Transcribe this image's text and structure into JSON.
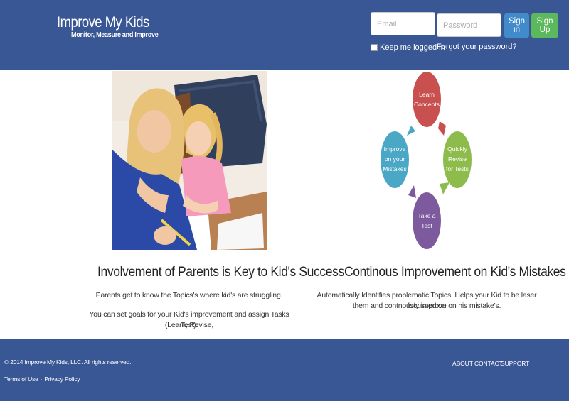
{
  "header": {
    "brand_title": "Improve My Kids",
    "brand_tagline": "Monitor, Measure and Improve",
    "email_placeholder": "Email",
    "password_placeholder": "Password",
    "sign_in_label": "Sign in",
    "sign_up_label": "Sign Up",
    "keep_logged_in_label": "Keep me logged in",
    "forgot_password_label": "Forgot your password?"
  },
  "cycle": {
    "learn": [
      "Learn",
      "Concepts"
    ],
    "revise": [
      "Quickly",
      "Revise",
      "for Tests"
    ],
    "test": [
      "Take a",
      "Test"
    ],
    "improve": [
      "Improve",
      "on your",
      "Mistakes"
    ]
  },
  "left_section": {
    "heading": "Involvement of Parents is Key to Kid's Success",
    "p1": "Parents get to know the Topics's where kid's are struggling.",
    "p2_line1": "You can set goals for your Kid's improvement and assign Tasks (Learn, Revise,",
    "p2_line2": "Test)."
  },
  "right_section": {
    "heading": "Continous Improvement on Kid's Mistakes",
    "p1_line1": "Automatically Identifies problematic Topics. Helps your Kid to be laser focussed on",
    "p1_line2": "them and contnously improve on his mistake's."
  },
  "footer": {
    "copyright": "© 2014 Improve My Kids, LLC. All rights reserved.",
    "terms": "Terms of Use",
    "privacy": "Privacy Policy",
    "separator": "·",
    "nav_about": "ABOUT",
    "nav_contact": "CONTACT",
    "nav_support": "SUPPORT"
  },
  "colors": {
    "brand_blue": "#3a5795",
    "sign_in": "#428bca",
    "sign_up": "#5cb85c",
    "learn_circle": "#c8504f",
    "revise_circle": "#8dbb4c",
    "test_circle": "#7d5a9e",
    "improve_circle": "#4aa7c6"
  }
}
